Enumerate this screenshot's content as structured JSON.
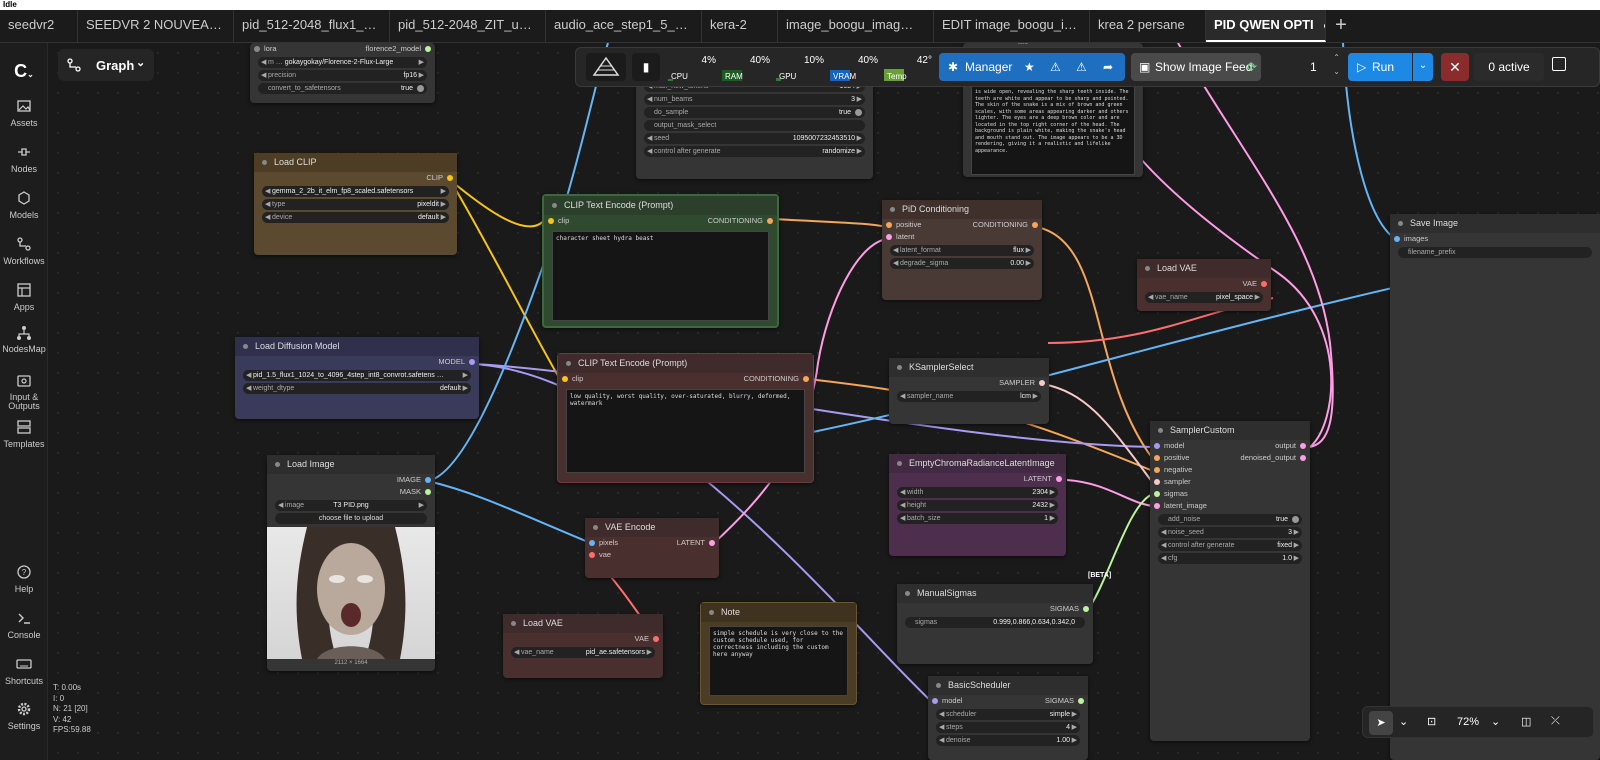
{
  "window_title": "Idle",
  "tabs": [
    "seedvr2",
    "SEEDVR 2 NOUVEA…",
    "pid_512-2048_flux1_…",
    "pid_512-2048_ZIT_u…",
    "audio_ace_step1_5_…",
    "kera-2",
    "image_boogu_imag…",
    "EDIT image_boogu_i…",
    "krea 2 persane",
    "PID QWEN OPTI"
  ],
  "sidebar": {
    "assets": "Assets",
    "nodes": "Nodes",
    "models": "Models",
    "workflows": "Workflows",
    "apps": "Apps",
    "nodesmap": "NodesMap",
    "io": "Input & Outputs",
    "templates": "Templates",
    "help": "Help",
    "console": "Console",
    "shortcuts": "Shortcuts",
    "settings": "Settings"
  },
  "graph_label": "Graph",
  "toolbar": {
    "cpu_label": "CPU",
    "cpu": "4%",
    "ram_label": "RAM",
    "ram": "40%",
    "gpu_label": "GPU",
    "gpu": "10%",
    "vram_label": "VRAM",
    "vram": "40%",
    "temp_label": "Temp",
    "temp": "42°",
    "manager": "Manager",
    "feed": "Show Image Feed",
    "batch": "1",
    "run": "Run",
    "active": "0 active",
    "cpu_level": 0.04,
    "ram_level": 0.4,
    "gpu_level": 0.1,
    "vram_level": 0.4,
    "temp_level": 0.42
  },
  "stats": {
    "t": "T: 0.00s",
    "i": "I: 0",
    "n": "N: 21 [20]",
    "v": "V: 42",
    "fps": "FPS:59.88"
  },
  "zoom": "72%",
  "nodes": {
    "lora": {
      "in": "lora",
      "out": "florence2_model",
      "model": "gokaygokay/Florence-2-Flux-Large",
      "model_prefix": "m …",
      "precision_l": "precision",
      "precision": "fp16",
      "convert_l": "convert_to_safetensors",
      "convert": "true"
    },
    "gen": {
      "max_l": "max_new_tokens",
      "max": "1024",
      "beams_l": "num_beams",
      "beams": "3",
      "sample_l": "do_sample",
      "sample": "true",
      "mask_l": "output_mask_select",
      "seed_l": "seed",
      "seed": "1095007232453510",
      "ctrl_l": "control after generate",
      "ctrl": "randomize"
    },
    "caption": {
      "text": "is wide open, revealing the sharp teeth inside. The teeth are white and appear to be sharp and pointed. The skin of the snake is a mix of brown and green scales, with some areas appearing darker and others lighter. The eyes are a deep brown color and are located in the top right corner of the head. The background is plain white, making the snake's head and mouth stand out. The image appears to be a 3D rendering, giving it a realistic and lifelike appearance.",
      "top_label": "text"
    },
    "load_clip": {
      "title": "Load CLIP",
      "out": "CLIP",
      "name": "gemma_2_2b_it_elm_fp8_scaled.safetensors",
      "type_l": "type",
      "type": "pixeldit",
      "device_l": "device",
      "device": "default"
    },
    "clip_pos": {
      "title": "CLIP Text Encode (Prompt)",
      "in": "clip",
      "out": "CONDITIONING",
      "text": "character sheet hydra beast"
    },
    "clip_neg": {
      "title": "CLIP Text Encode (Prompt)",
      "in": "clip",
      "out": "CONDITIONING",
      "text": "low quality, worst quality, over-saturated, blurry, deformed, watermark"
    },
    "pid_cond": {
      "title": "PiD Conditioning",
      "in1": "positive",
      "in2": "latent",
      "out": "CONDITIONING",
      "lf_l": "latent_format",
      "lf": "flux",
      "ds_l": "degrade_sigma",
      "ds": "0.00"
    },
    "load_vae_r": {
      "title": "Load VAE",
      "out": "VAE",
      "name_l": "vae_name",
      "name": "pixel_space"
    },
    "save": {
      "title": "Save Image",
      "in": "images",
      "prefix": "filename_prefix"
    },
    "diff": {
      "title": "Load Diffusion Model",
      "out": "MODEL",
      "name": "pid_1.5_flux1_1024_to_4096_4step_int8_convrot.safetens …",
      "wd_l": "weight_dtype",
      "wd": "default"
    },
    "ksel": {
      "title": "KSamplerSelect",
      "out": "SAMPLER",
      "sn_l": "sampler_name",
      "sn": "lcm"
    },
    "scustom": {
      "title": "SamplerCustom",
      "in": [
        "model",
        "positive",
        "negative",
        "sampler",
        "sigmas",
        "latent_image"
      ],
      "out1": "output",
      "out2": "denoised_output",
      "an_l": "add_noise",
      "an": "true",
      "ns_l": "noise_seed",
      "ns": "3",
      "cag_l": "control after generate",
      "cag": "fixed",
      "cfg_l": "cfg",
      "cfg": "1.0"
    },
    "load_image": {
      "title": "Load Image",
      "out1": "IMAGE",
      "out2": "MASK",
      "img_l": "image",
      "img": "T3 PID.png",
      "upload": "choose file to upload",
      "dims": "2112 × 1664"
    },
    "vae_enc": {
      "title": "VAE Encode",
      "in1": "pixels",
      "in2": "vae",
      "out": "LATENT"
    },
    "ecr": {
      "title": "EmptyChromaRadianceLatentImage",
      "out": "LATENT",
      "w_l": "width",
      "w": "2304",
      "h_l": "height",
      "h": "2432",
      "b_l": "batch_size",
      "b": "1"
    },
    "msig": {
      "beta": "[BETA]",
      "title": "ManualSigmas",
      "out": "SIGMAS",
      "s_l": "sigmas",
      "s": "0.999,0.866,0.634,0.342,0"
    },
    "load_vae": {
      "title": "Load VAE",
      "out": "VAE",
      "name_l": "vae_name",
      "name": "pid_ae.safetensors"
    },
    "note": {
      "title": "Note",
      "text": "simple schedule is very close to the custom schedule used, for correctness including the custom here anyway"
    },
    "bsched": {
      "title": "BasicScheduler",
      "in": "model",
      "out": "SIGMAS",
      "sch_l": "scheduler",
      "sch": "simple",
      "st_l": "steps",
      "st": "4",
      "dn_l": "denoise",
      "dn": "1.00"
    }
  },
  "colors": {
    "clip": "#f5c518",
    "model": "#a99bf4",
    "conditioning": "#f4a65a",
    "latent": "#ff9ce6",
    "image": "#64b5f6",
    "vae": "#ff6e6e",
    "sigmas": "#baf59e",
    "sampler": "#f7c8c8"
  }
}
